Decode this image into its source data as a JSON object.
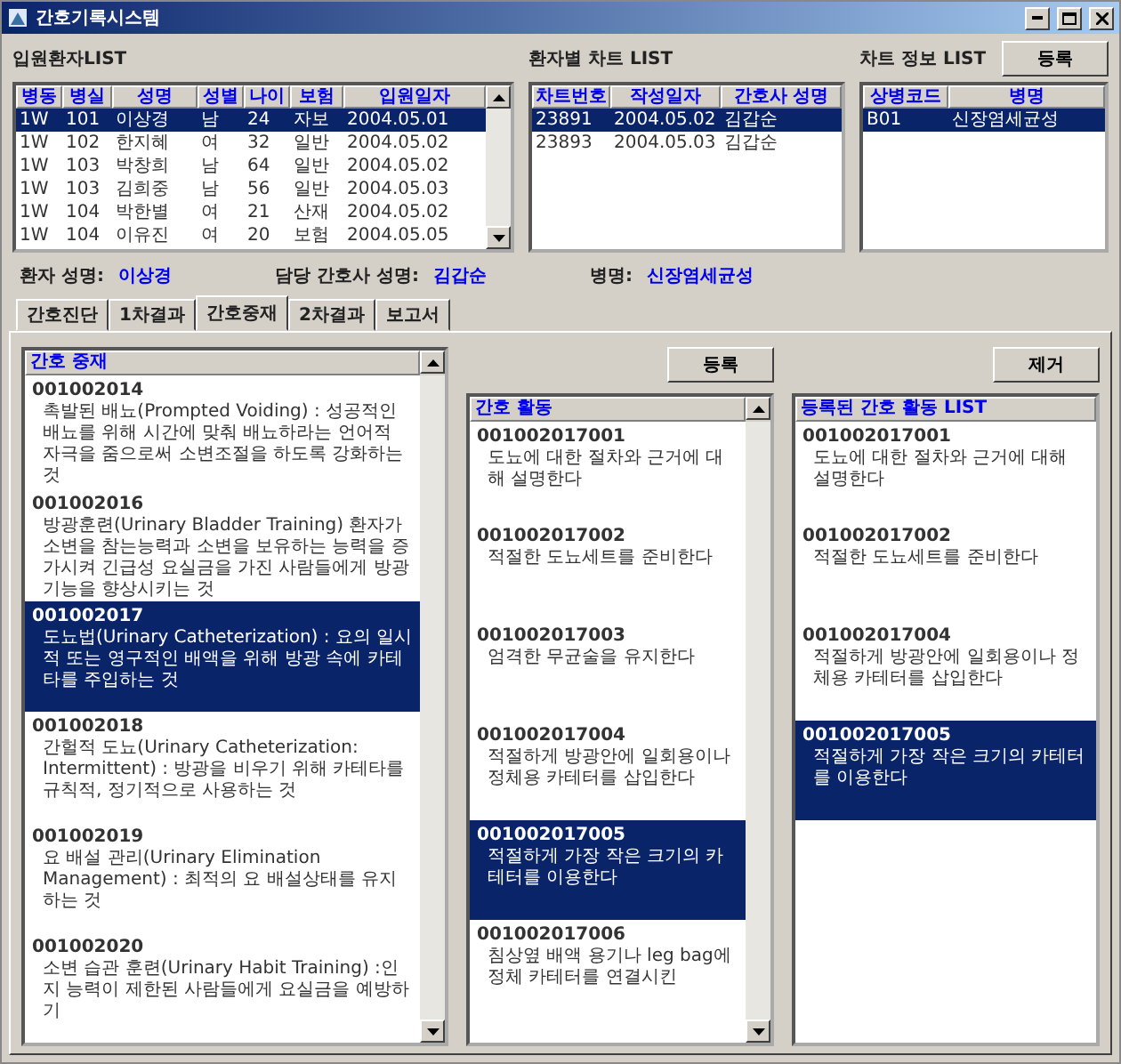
{
  "window": {
    "title": "간호기록시스템"
  },
  "admissions": {
    "title": "입원환자LIST",
    "columns": [
      "병동",
      "병실",
      "성명",
      "성별",
      "나이",
      "보험",
      "입원일자"
    ],
    "rows": [
      {
        "cells": [
          "1W",
          "101",
          "이상경",
          "남",
          "24",
          "자보",
          "2004.05.01"
        ],
        "selected": true
      },
      {
        "cells": [
          "1W",
          "102",
          "한지혜",
          "여",
          "32",
          "일반",
          "2004.05.02"
        ],
        "selected": false
      },
      {
        "cells": [
          "1W",
          "103",
          "박창희",
          "남",
          "64",
          "일반",
          "2004.05.02"
        ],
        "selected": false
      },
      {
        "cells": [
          "1W",
          "103",
          "김희중",
          "남",
          "56",
          "일반",
          "2004.05.03"
        ],
        "selected": false
      },
      {
        "cells": [
          "1W",
          "104",
          "박한별",
          "여",
          "21",
          "산재",
          "2004.05.02"
        ],
        "selected": false
      },
      {
        "cells": [
          "1W",
          "104",
          "이유진",
          "여",
          "20",
          "보험",
          "2004.05.05"
        ],
        "selected": false
      }
    ]
  },
  "charts": {
    "title": "환자별 차트 LIST",
    "columns": [
      "차트번호",
      "작성일자",
      "간호사 성명"
    ],
    "rows": [
      {
        "cells": [
          "23891",
          "2004.05.02",
          "김갑순"
        ],
        "selected": true
      },
      {
        "cells": [
          "23893",
          "2004.05.03",
          "김갑순"
        ],
        "selected": false
      }
    ]
  },
  "chart_info": {
    "title": "차트 정보 LIST",
    "button": "등록",
    "columns": [
      "상병코드",
      "병명"
    ],
    "rows": [
      {
        "cells": [
          "B01",
          "신장염세균성"
        ],
        "selected": true
      }
    ]
  },
  "patient_info": [
    {
      "label": "환자 성명:",
      "value": "이상경"
    },
    {
      "label": "담당 간호사 성명:",
      "value": "김갑순"
    },
    {
      "label": "병명:",
      "value": "신장염세균성"
    }
  ],
  "tabs": [
    {
      "label": "간호진단",
      "selected": false
    },
    {
      "label": "1차결과",
      "selected": false
    },
    {
      "label": "간호중재",
      "selected": true
    },
    {
      "label": "2차결과",
      "selected": false
    },
    {
      "label": "보고서",
      "selected": false
    }
  ],
  "interventions": {
    "title": "간호 중재",
    "items": [
      {
        "code": "001002014",
        "text": "촉발된 배뇨(Prompted Voiding) : 성공적인 배뇨를 위해 시간에 맞춰 배뇨하라는 언어적 자극을 줌으로써 소변조절을 하도록 강화하는 것",
        "selected": false
      },
      {
        "code": "001002016",
        "text": "방광훈련(Urinary Bladder Training) 환자가 소변을 참는능력과 소변을 보유하는 능력을 증가시켜 긴급성 요실금을 가진 사람들에게 방광기능을 향상시키는 것",
        "selected": false
      },
      {
        "code": "001002017",
        "text": "도뇨법(Urinary Catheterization) : 요의 일시적 또는 영구적인 배액을 위해 방광 속에 카테타를 주입하는 것",
        "selected": true
      },
      {
        "code": "001002018",
        "text": "간헐적 도뇨(Urinary Catheterization: Intermittent) : 방광을 비우기 위해 카테타를 규칙적, 정기적으로 사용하는 것",
        "selected": false
      },
      {
        "code": "001002019",
        "text": "요 배설 관리(Urinary Elimination Management) : 최적의 요 배설상태를 유지하는 것",
        "selected": false
      },
      {
        "code": "001002020",
        "text": "소변 습관 훈련(Urinary Habit Training) :인지 능력이 제한된 사람들에게 요실금을 예방하기",
        "selected": false
      }
    ]
  },
  "activities": {
    "title": "간호 활동",
    "button": "등록",
    "items": [
      {
        "code": "001002017001",
        "text": "도뇨에 대한 절차와 근거에 대해 설명한다",
        "selected": false
      },
      {
        "code": "001002017002",
        "text": "적절한 도뇨세트를 준비한다",
        "selected": false
      },
      {
        "code": "001002017003",
        "text": "엄격한 무균술을 유지한다",
        "selected": false
      },
      {
        "code": "001002017004",
        "text": "적절하게 방광안에 일회용이나 정체용 카테터를 삽입한다",
        "selected": false
      },
      {
        "code": "001002017005",
        "text": "적절하게 가장 작은 크기의 카테터를 이용한다",
        "selected": true
      },
      {
        "code": "001002017006",
        "text": "침상옆 배액 용기나 leg bag에 정체 카테터를 연결시킨",
        "selected": false
      }
    ]
  },
  "registered": {
    "title": "등록된 간호 활동 LIST",
    "button": "제거",
    "items": [
      {
        "code": "001002017001",
        "text": "도뇨에 대한 절차와 근거에 대해 설명한다",
        "selected": false
      },
      {
        "code": "001002017002",
        "text": "적절한 도뇨세트를 준비한다",
        "selected": false
      },
      {
        "code": "001002017004",
        "text": "적절하게 방광안에 일회용이나 정체용 카테터를 삽입한다",
        "selected": false
      },
      {
        "code": "001002017005",
        "text": "적절하게 가장 작은 크기의 카테터를 이용한다",
        "selected": true
      }
    ]
  }
}
